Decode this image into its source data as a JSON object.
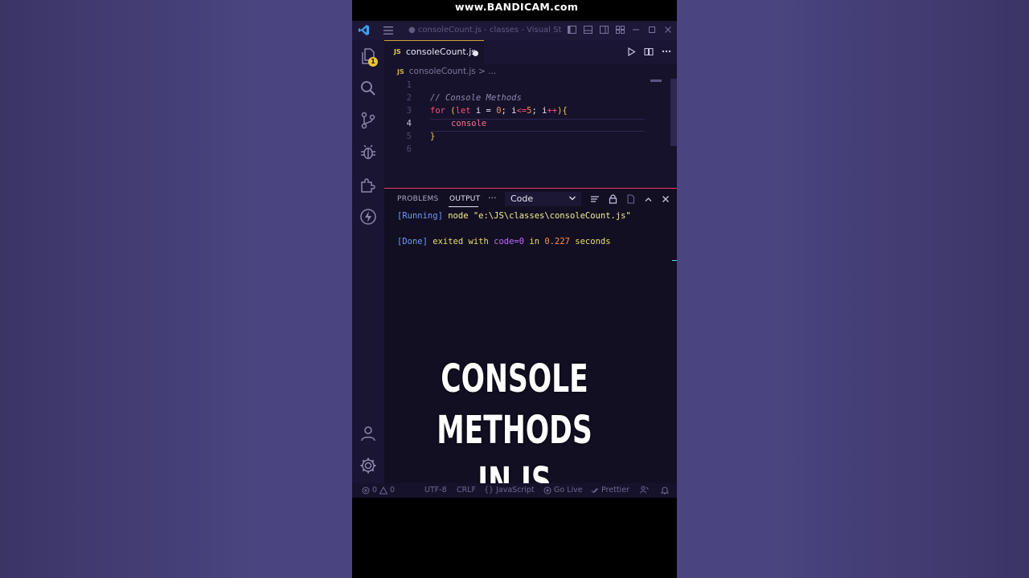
{
  "watermark": "www.BANDICAM.com",
  "titlebar": {
    "title": "● consoleCount.js - classes - Visual St"
  },
  "activity": {
    "badge_count": "1"
  },
  "tab": {
    "file_icon": "JS",
    "name": "consoleCount.js"
  },
  "breadcrumb": {
    "file_icon": "JS",
    "path": "consoleCount.js",
    "sep": "> ..."
  },
  "editor": {
    "line_numbers": [
      "1",
      "2",
      "3",
      "4",
      "5",
      "6"
    ],
    "line2_comment": "// Console Methods",
    "line3": {
      "for": "for",
      "open_paren": "(",
      "let": "let",
      "decl": " i = ",
      "zero": "0",
      "semi1": "; i",
      "lte": "<=",
      "five": "5",
      "semi2": "; i",
      "inc": "++",
      "close": ")",
      "brace": "{"
    },
    "line4_text": "console",
    "line5_text": "}"
  },
  "panel": {
    "tab_problems": "PROBLEMS",
    "tab_output": "OUTPUT",
    "more": "···",
    "select_value": "Code",
    "out_line1": {
      "running": "[Running]",
      "cmd": " node \"e:\\JS\\classes\\consoleCount.js\""
    },
    "out_line2": {
      "done": "[Done]",
      "exited": " exited with ",
      "code": "code=0",
      "in": " in ",
      "time": "0.227",
      "seconds": " seconds"
    }
  },
  "overlay": {
    "line1": "CONSOLE",
    "line2": "METHODS",
    "line3": "IN JS"
  },
  "statusbar": {
    "errors": "0",
    "warnings": "0",
    "encoding": "UTF-8",
    "eol": "CRLF",
    "language": "JavaScript",
    "golive": "Go Live",
    "prettier": "Prettier"
  },
  "colors": {
    "accent": "#ec3a63",
    "tab_border": "#d0a43a",
    "background": "#16122b"
  }
}
